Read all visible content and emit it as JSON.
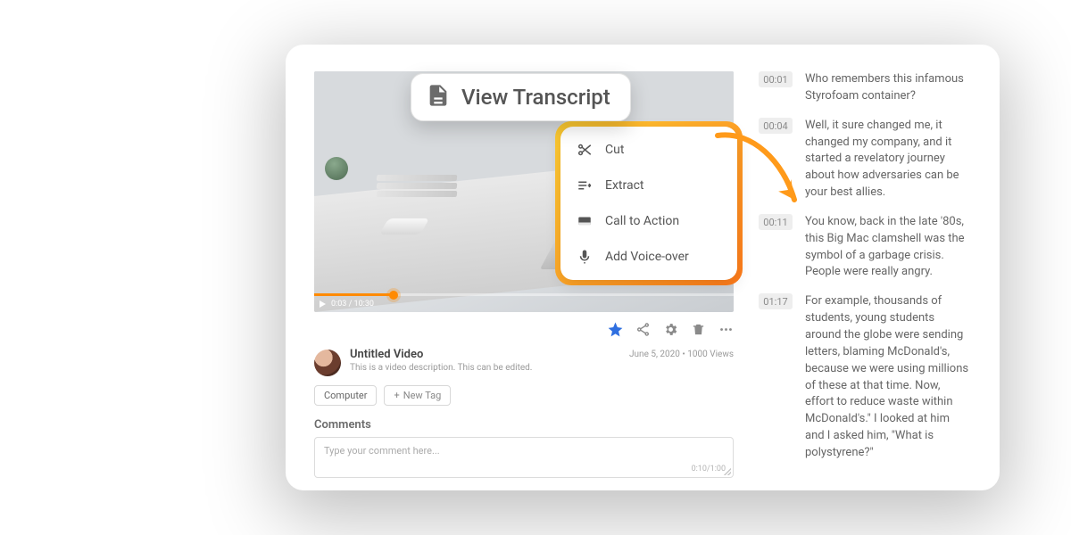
{
  "callout": {
    "label": "View Transcript"
  },
  "menu": {
    "items": [
      {
        "id": "cut",
        "label": "Cut"
      },
      {
        "id": "extract",
        "label": "Extract"
      },
      {
        "id": "cta",
        "label": "Call to Action"
      },
      {
        "id": "voice",
        "label": "Add Voice-over"
      }
    ]
  },
  "player": {
    "time_current": "0:03",
    "time_total": "10:30",
    "time_display": "0:03 / 10:30"
  },
  "video": {
    "title": "Untitled Video",
    "description": "This is a video description. This can be edited.",
    "date": "June 5, 2020",
    "views": "1000 Views",
    "meta_sep": "  •  "
  },
  "tags": {
    "existing": [
      "Computer"
    ],
    "new_label": "New Tag"
  },
  "comments": {
    "heading": "Comments",
    "placeholder": "Type your comment here...",
    "counter": "0:10/1:00"
  },
  "transcript": [
    {
      "time": "00:01",
      "text": "Who remembers this infamous Styrofoam container?"
    },
    {
      "time": "00:04",
      "text": "Well, it sure changed me, it changed my company, and it started a revelatory journey about how adversaries can be your best allies."
    },
    {
      "time": "00:11",
      "text": "You know, back in the late '80s, this Big Mac clamshell was the symbol of a garbage crisis. People were really angry."
    },
    {
      "time": "01:17",
      "text": "For example, thousands of students, young students around the globe were sending letters, blaming McDonald's, because we were using millions of these at that time. Now, effort to reduce waste within McDonald's.\" I looked at him and I asked him, \"What is polystyrene?\""
    }
  ]
}
